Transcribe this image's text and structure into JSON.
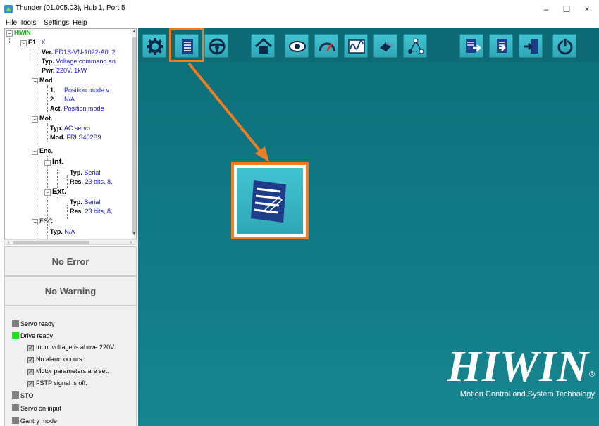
{
  "window": {
    "title": "Thunder (01.005.03), Hub 1, Port 5",
    "minimize": "–",
    "maximize": "☐",
    "close": "×"
  },
  "menu": [
    "File",
    "Tools",
    "Settings",
    "Help"
  ],
  "tree": {
    "root": "HIWIN",
    "e1_label": "E1",
    "e1_value": "X",
    "ver_label": "Ver.",
    "ver_value": "ED1S-VN-1022-A0, 2",
    "typ_label": "Typ.",
    "typ_value": "Voltage command an",
    "pwr_label": "Pwr.",
    "pwr_value": "220V, 1kW",
    "mod_label": "Mod",
    "mod1_label": "1.",
    "mod1_value": "Position mode v",
    "mod2_label": "2.",
    "mod2_value": "N/A",
    "act_label": "Act.",
    "act_value": "Position mode",
    "mot_label": "Mot.",
    "mot_typ_label": "Typ.",
    "mot_typ_value": "AC servo",
    "mot_mod_label": "Mod.",
    "mot_mod_value": "FRLS402B9",
    "enc_label": "Enc.",
    "int_label": "Int.",
    "int_typ_label": "Typ.",
    "int_typ_value": "Serial",
    "int_res_label": "Res.",
    "int_res_value": "23 bits, 8,",
    "ext_label": "Ext.",
    "ext_typ_label": "Typ.",
    "ext_typ_value": "Serial",
    "ext_res_label": "Res.",
    "ext_res_value": "23 bits, 8,",
    "esc_label": "ESC",
    "esc_typ_label": "Typ.",
    "esc_typ_value": "N/A"
  },
  "status": {
    "error": "No Error",
    "warning": "No Warning"
  },
  "indicators": {
    "servo_ready": "Servo ready",
    "drive_ready": "Drive ready",
    "check1": "Input voltage is above 220V.",
    "check2": "No alarm occurs.",
    "check3": "Motor parameters are set.",
    "check4": "FSTP signal is off.",
    "sto": "STO",
    "servo_on_input": "Servo on input",
    "gantry_mode": "Gantry mode"
  },
  "toolbar": {
    "icons": [
      "gear-icon",
      "document-edit-icon",
      "steering-wheel-icon",
      "home-icon",
      "eye-icon",
      "gauge-icon",
      "waveform-icon",
      "tools-icon",
      "network-icon",
      "export-icon",
      "import-icon",
      "save-icon",
      "power-icon"
    ]
  },
  "logo": {
    "word": "HIWIN",
    "reg": "®",
    "tagline": "Motion Control and System Technology"
  },
  "colors": {
    "main_bg": "#107884",
    "button_bg": "#35aebd",
    "highlight": "#ef7d22",
    "drive_ready": "#19e519",
    "tree_value": "#1515d8"
  }
}
